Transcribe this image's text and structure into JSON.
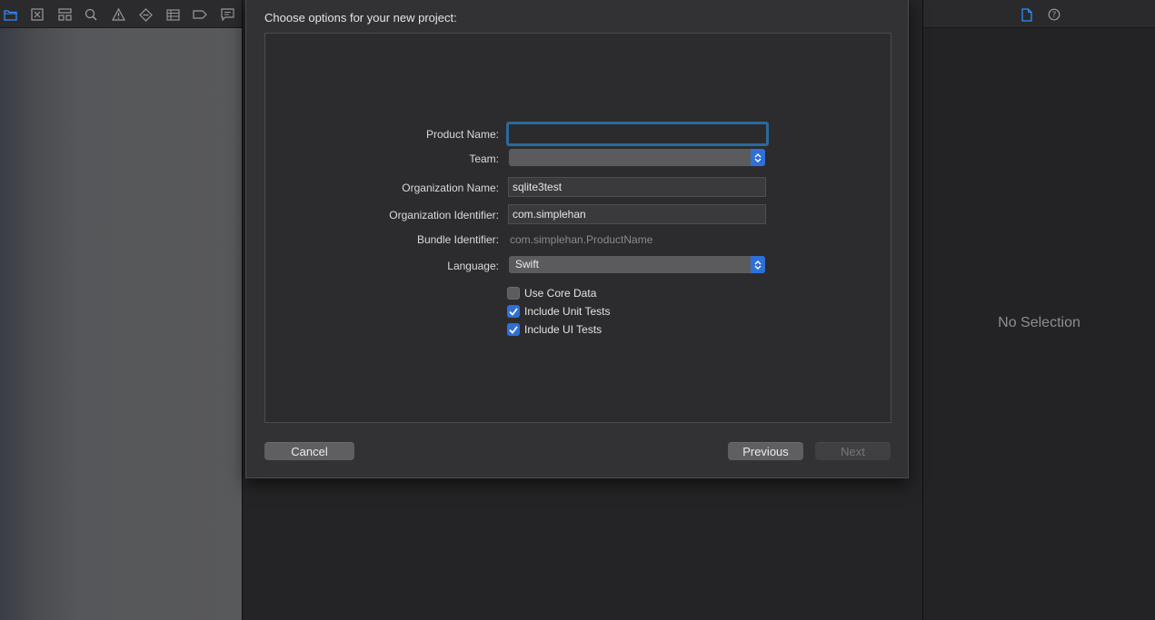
{
  "navigator": {
    "toolbar_icons": [
      "folder-icon",
      "x-square-icon",
      "hierarchy-icon",
      "search-icon",
      "warning-icon",
      "diamond-icon",
      "list-icon",
      "tag-icon",
      "comment-icon"
    ],
    "accent": "#2f8cff"
  },
  "inspector": {
    "toolbar_icons": [
      "file-icon",
      "help-icon"
    ],
    "empty_state": "No Selection"
  },
  "dialog": {
    "title": "Choose options for your new project:",
    "fields": {
      "product_name": {
        "label": "Product Name:",
        "value": ""
      },
      "team": {
        "label": "Team:",
        "value": ""
      },
      "organization_name": {
        "label": "Organization Name:",
        "value": "sqlite3test"
      },
      "organization_identifier": {
        "label": "Organization Identifier:",
        "value": "com.simplehan"
      },
      "bundle_identifier": {
        "label": "Bundle Identifier:",
        "value": "com.simplehan.ProductName"
      },
      "language": {
        "label": "Language:",
        "value": "Swift"
      }
    },
    "checkboxes": [
      {
        "label": "Use Core Data",
        "checked": false
      },
      {
        "label": "Include Unit Tests",
        "checked": true
      },
      {
        "label": "Include UI Tests",
        "checked": true
      }
    ],
    "buttons": {
      "cancel": "Cancel",
      "previous": "Previous",
      "next": "Next"
    },
    "colors": {
      "focus_ring": "#2a6a9e",
      "popup_accent": "#2f6fd8"
    }
  }
}
